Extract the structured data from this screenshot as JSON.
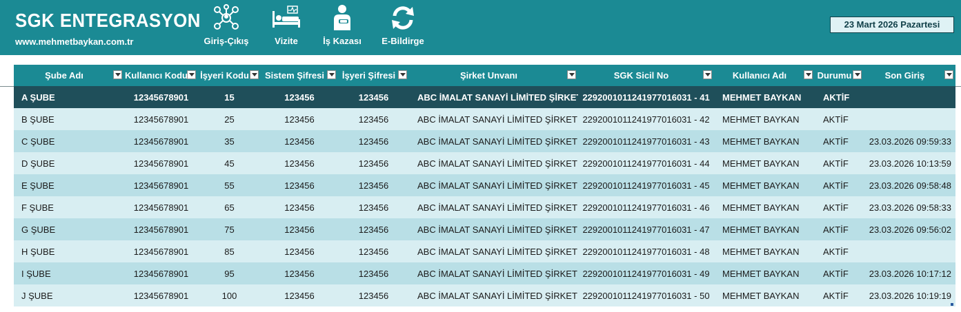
{
  "header": {
    "title": "SGK ENTEGRASYON",
    "url": "www.mehmetbaykan.com.tr",
    "date": "23 Mart 2026 Pazartesi",
    "nav": [
      {
        "label": "Giriş-Çıkış",
        "icon": "people-network-icon"
      },
      {
        "label": "Vizite",
        "icon": "hospital-bed-icon"
      },
      {
        "label": "İş Kazası",
        "icon": "injured-person-icon"
      },
      {
        "label": "E-Bildirge",
        "icon": "refresh-icon"
      }
    ]
  },
  "table": {
    "columns": [
      "Şube Adı",
      "Kullanıcı Kodu",
      "İşyeri Kodu",
      "Sistem Şifresi",
      "İşyeri Şifresi",
      "Şirket Unvanı",
      "SGK Sicil No",
      "Kullanıcı Adı",
      "Durumu",
      "Son Giriş"
    ],
    "selected_row": 0,
    "rows": [
      [
        "A ŞUBE",
        "12345678901",
        "15",
        "123456",
        "123456",
        "ABC İMALAT SANAYİ LİMİTED ŞİRKETİ",
        "2292001011241977016031 - 41",
        "MEHMET BAYKAN",
        "AKTİF",
        ""
      ],
      [
        "B ŞUBE",
        "12345678901",
        "25",
        "123456",
        "123456",
        "ABC İMALAT SANAYİ LİMİTED ŞİRKETİ",
        "2292001011241977016031 - 42",
        "MEHMET BAYKAN",
        "AKTİF",
        ""
      ],
      [
        "C ŞUBE",
        "12345678901",
        "35",
        "123456",
        "123456",
        "ABC İMALAT SANAYİ LİMİTED ŞİRKETİ",
        "2292001011241977016031 - 43",
        "MEHMET BAYKAN",
        "AKTİF",
        "23.03.2026 09:59:33"
      ],
      [
        "D ŞUBE",
        "12345678901",
        "45",
        "123456",
        "123456",
        "ABC İMALAT SANAYİ LİMİTED ŞİRKETİ",
        "2292001011241977016031 - 44",
        "MEHMET BAYKAN",
        "AKTİF",
        "23.03.2026 10:13:59"
      ],
      [
        "E ŞUBE",
        "12345678901",
        "55",
        "123456",
        "123456",
        "ABC İMALAT SANAYİ LİMİTED ŞİRKETİ",
        "2292001011241977016031 - 45",
        "MEHMET BAYKAN",
        "AKTİF",
        "23.03.2026 09:58:48"
      ],
      [
        "F ŞUBE",
        "12345678901",
        "65",
        "123456",
        "123456",
        "ABC İMALAT SANAYİ LİMİTED ŞİRKETİ",
        "2292001011241977016031 - 46",
        "MEHMET BAYKAN",
        "AKTİF",
        "23.03.2026 09:58:33"
      ],
      [
        "G ŞUBE",
        "12345678901",
        "75",
        "123456",
        "123456",
        "ABC İMALAT SANAYİ LİMİTED ŞİRKETİ",
        "2292001011241977016031 - 47",
        "MEHMET BAYKAN",
        "AKTİF",
        "23.03.2026 09:56:02"
      ],
      [
        "H ŞUBE",
        "12345678901",
        "85",
        "123456",
        "123456",
        "ABC İMALAT SANAYİ LİMİTED ŞİRKETİ",
        "2292001011241977016031 - 48",
        "MEHMET BAYKAN",
        "AKTİF",
        ""
      ],
      [
        "I ŞUBE",
        "12345678901",
        "95",
        "123456",
        "123456",
        "ABC İMALAT SANAYİ LİMİTED ŞİRKETİ",
        "2292001011241977016031 - 49",
        "MEHMET BAYKAN",
        "AKTİF",
        "23.03.2026 10:17:12"
      ],
      [
        "J ŞUBE",
        "12345678901",
        "100",
        "123456",
        "123456",
        "ABC İMALAT SANAYİ LİMİTED ŞİRKETİ",
        "2292001011241977016031 - 50",
        "MEHMET BAYKAN",
        "AKTİF",
        "23.03.2026 10:19:19"
      ]
    ]
  },
  "colors": {
    "header_bg": "#1b8a94",
    "selected_row_bg": "#1f4f5a",
    "row_light": "#d8eef2",
    "row_dark": "#b9dfe6"
  }
}
